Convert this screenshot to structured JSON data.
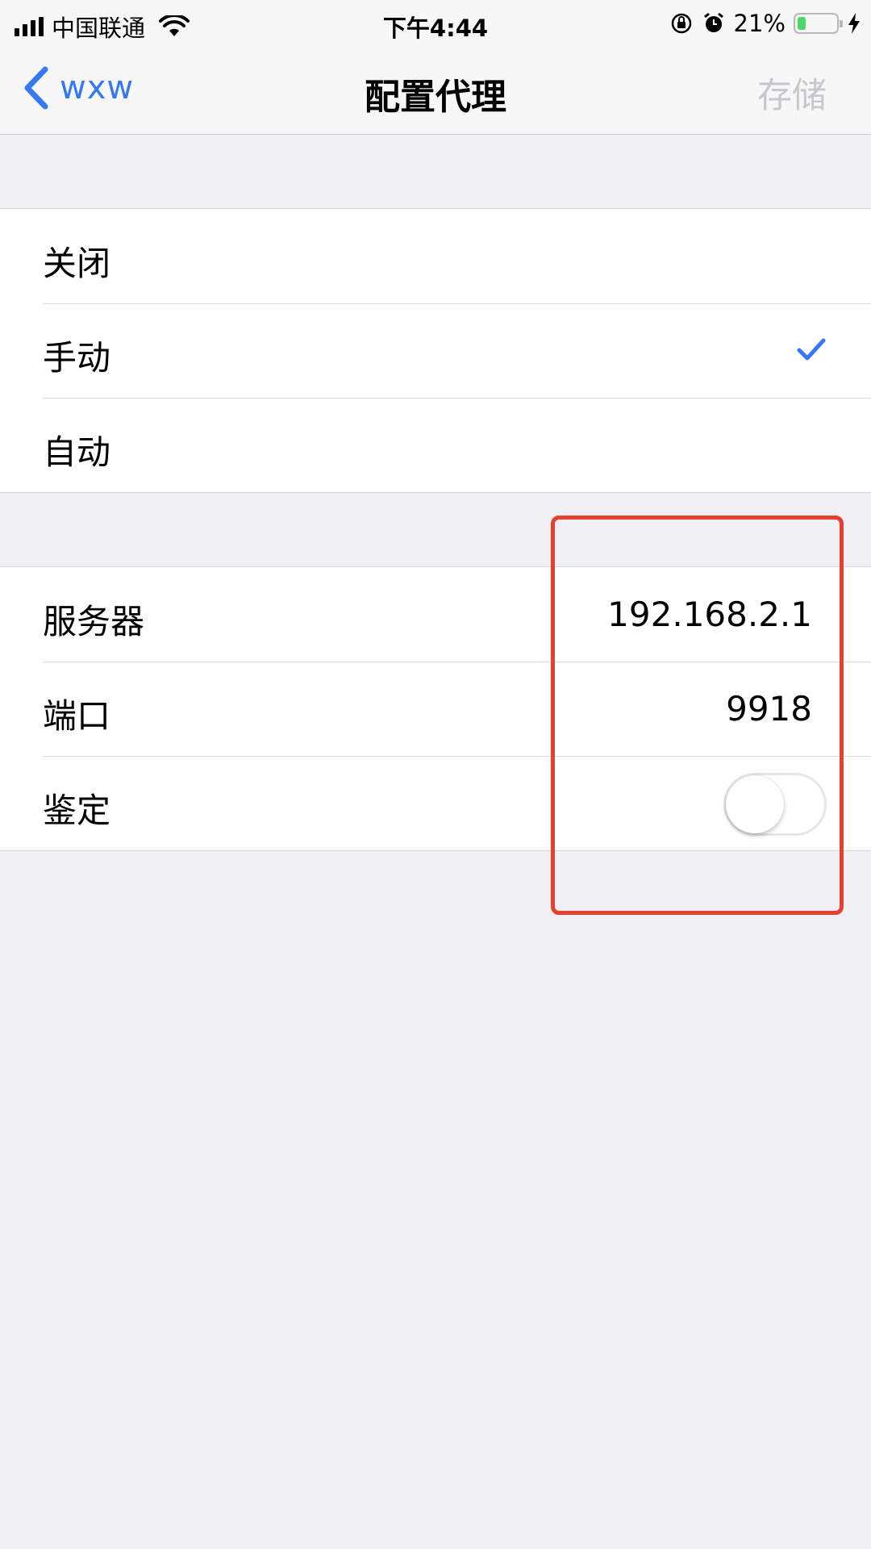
{
  "status_bar": {
    "carrier": "中国联通",
    "time": "下午4:44",
    "battery_percent_text": "21%",
    "battery_level": 0.21,
    "signal_bars": 4
  },
  "nav": {
    "back_label": "wxw",
    "title": "配置代理",
    "save_label": "存储"
  },
  "proxy_modes": [
    {
      "label": "关闭",
      "selected": false
    },
    {
      "label": "手动",
      "selected": true
    },
    {
      "label": "自动",
      "selected": false
    }
  ],
  "settings": {
    "server_label": "服务器",
    "server_value": "192.168.2.1",
    "port_label": "端口",
    "port_value": "9918",
    "auth_label": "鉴定",
    "auth_enabled": false
  },
  "colors": {
    "accent": "#3478f6",
    "highlight": "#e8402e",
    "battery": "#4cd964"
  }
}
